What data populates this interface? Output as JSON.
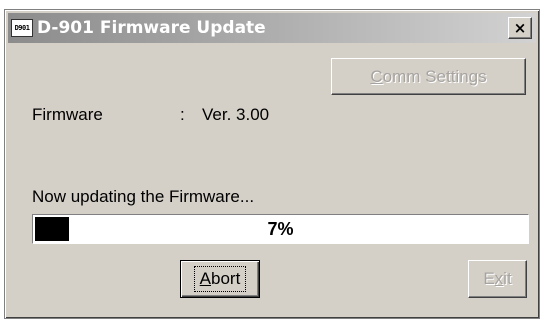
{
  "window": {
    "title": "D-901 Firmware Update",
    "icon_text": "D901",
    "close_glyph": "×"
  },
  "buttons": {
    "comm_settings": {
      "mnemonic": "C",
      "rest": "omm Settings",
      "enabled": false
    },
    "abort": {
      "mnemonic": "A",
      "rest": "bort",
      "enabled": true
    },
    "exit": {
      "pre": "E",
      "mnemonic": "x",
      "post": "it",
      "enabled": false
    }
  },
  "firmware": {
    "label": "Firmware",
    "separator": ":",
    "version": "Ver. 3.00"
  },
  "status": {
    "message": "Now updating the Firmware..."
  },
  "progress": {
    "percent_text": "7%",
    "fraction": 0.07
  },
  "colors": {
    "face": "#d4d0c8",
    "title_gradient_start": "#8c8c8c",
    "progress_fill": "#000000"
  }
}
